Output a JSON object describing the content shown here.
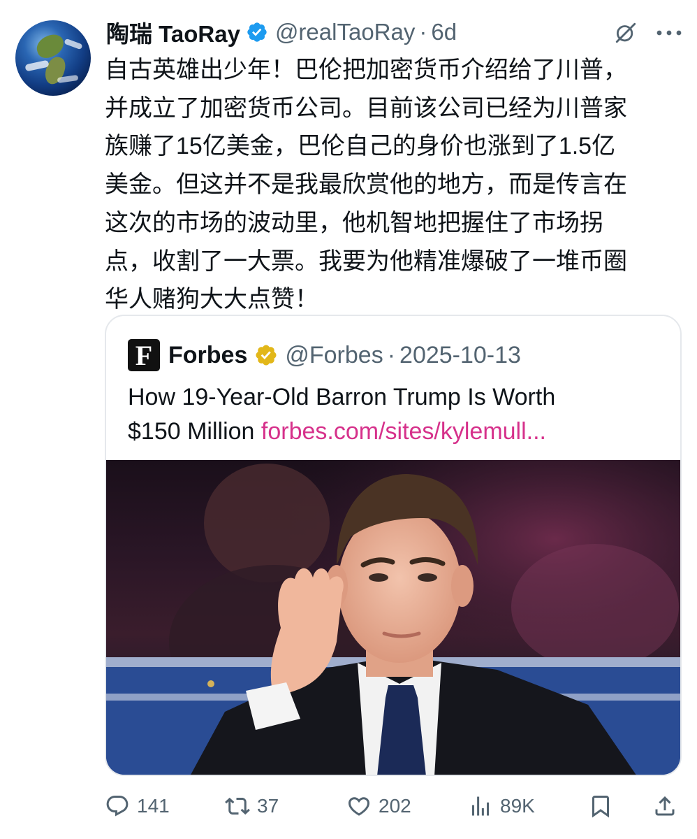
{
  "author": {
    "display_name": "陶瑞 TaoRay",
    "handle": "@realTaoRay",
    "separator": "·",
    "time": "6d",
    "avatar_icon": "earth-globe"
  },
  "tweet": {
    "lines": [
      "自古英雄出少年！巴伦把加密货币介绍给了川普，",
      "并成立了加密货币公司。目前该公司已经为川普家",
      "族赚了15亿美金，巴伦自己的身价也涨到了1.5亿",
      "美金。但这并不是我最欣赏他的地方，而是传言在",
      "这次的市场的波动里，他机智地把握住了市场拐",
      "点，收割了一大票。我要为他精准爆破了一堆币圈",
      "华人赌狗大大点赞！"
    ]
  },
  "quote": {
    "logo_letter": "F",
    "name": "Forbes",
    "handle": "@Forbes",
    "separator": "·",
    "date": "2025-10-13",
    "text_line1": "How 19-Year-Old Barron Trump Is Worth",
    "text_line2_prefix": "$150 Million ",
    "link": "forbes.com/sites/kylemull..."
  },
  "actions": {
    "replies": "141",
    "reposts": "37",
    "likes": "202",
    "views": "89K"
  },
  "colors": {
    "text": "#0f1419",
    "secondary": "#536471",
    "verified_blue": "#1d9bf0",
    "verified_gold": "#e2b719",
    "link": "#d6318b",
    "border": "#e5e8ec"
  }
}
